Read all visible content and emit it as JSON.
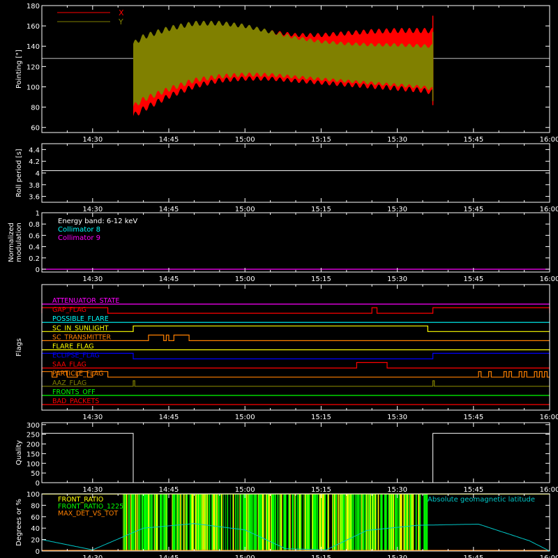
{
  "chart_data": [
    {
      "id": "pointing",
      "type": "line",
      "ylabel": "Pointing [\"]",
      "ylim": [
        55,
        180
      ],
      "yticks": [
        60,
        80,
        100,
        120,
        140,
        160,
        180
      ],
      "xlim": [
        "14:20",
        "16:00"
      ],
      "xticks": [
        "14:30",
        "14:45",
        "15:00",
        "15:15",
        "15:30",
        "15:45",
        "16:00"
      ],
      "legend_placement": "top-left",
      "series": [
        {
          "name": "X",
          "color": "#ff0000",
          "kind": "oscillating band",
          "time": [
            "14:38",
            "14:40",
            "14:45",
            "14:50",
            "14:55",
            "15:00",
            "15:05",
            "15:10",
            "15:15",
            "15:20",
            "15:25",
            "15:30",
            "15:35",
            "15:37"
          ],
          "upper": [
            145,
            150,
            156,
            162,
            163,
            160,
            156,
            153,
            153,
            155,
            157,
            158,
            158,
            158
          ],
          "lower": [
            68,
            75,
            88,
            98,
            104,
            106,
            106,
            104,
            102,
            100,
            98,
            96,
            94,
            92
          ]
        },
        {
          "name": "Y",
          "color": "#808000",
          "kind": "oscillating band",
          "time": [
            "14:38",
            "14:40",
            "14:45",
            "14:50",
            "14:55",
            "15:00",
            "15:05",
            "15:10",
            "15:15",
            "15:20",
            "15:25",
            "15:30",
            "15:35",
            "15:37"
          ],
          "upper": [
            145,
            152,
            160,
            165,
            165,
            162,
            156,
            150,
            146,
            144,
            143,
            143,
            142,
            142
          ],
          "lower": [
            78,
            85,
            95,
            104,
            108,
            110,
            110,
            108,
            106,
            104,
            102,
            100,
            98,
            96
          ]
        }
      ],
      "reference_line": {
        "value": 128,
        "color": "#c0c0c0"
      }
    },
    {
      "id": "roll",
      "type": "line",
      "ylabel": "Roll period [s]",
      "ylim": [
        3.5,
        4.5
      ],
      "yticks": [
        3.6,
        3.8,
        4.0,
        4.2,
        4.4
      ],
      "xlim": [
        "14:20",
        "16:00"
      ],
      "xticks": [
        "14:30",
        "14:45",
        "15:00",
        "15:15",
        "15:30",
        "15:45",
        "16:00"
      ],
      "series": [
        {
          "color": "#ffffff",
          "x": [
            "14:20",
            "16:00"
          ],
          "values": [
            4.04,
            4.04
          ]
        }
      ]
    },
    {
      "id": "modulation",
      "type": "line",
      "ylabel": "Normalized modulation",
      "ylim": [
        -0.05,
        1.0
      ],
      "yticks": [
        0.0,
        0.2,
        0.4,
        0.6,
        0.8,
        1.0
      ],
      "xlim": [
        "14:20",
        "16:00"
      ],
      "xticks": [
        "14:30",
        "14:45",
        "15:00",
        "15:15",
        "15:30",
        "15:45",
        "16:00"
      ],
      "annotation": "Energy band: 6-12 keV",
      "series": [
        {
          "name": "Collimator 8",
          "color": "#00ffff",
          "x": [],
          "values": []
        },
        {
          "name": "Collimator 9",
          "color": "#ff00ff",
          "x": [
            "14:20",
            "16:00"
          ],
          "values": [
            0.0,
            0.0
          ]
        }
      ]
    },
    {
      "id": "flags",
      "type": "line",
      "ylabel": "Flags",
      "xlim": [
        "14:20",
        "16:00"
      ],
      "xticks": [
        "14:30",
        "14:45",
        "15:00",
        "15:15",
        "15:30",
        "15:45",
        "16:00"
      ],
      "series": [
        {
          "name": "ATTENUATOR_STATE",
          "color": "#ff00ff",
          "on": []
        },
        {
          "name": "GAP_FLAG",
          "color": "#ff0000",
          "on": [
            [
              "14:20",
              "14:33"
            ],
            [
              "15:25",
              "15:26"
            ],
            [
              "15:37",
              "16:00"
            ]
          ]
        },
        {
          "name": "POSSIBLE_FLARE",
          "color": "#00ffff",
          "on": []
        },
        {
          "name": "SC_IN_SUNLIGHT",
          "color": "#ffff00",
          "on": [
            [
              "14:38",
              "15:36"
            ]
          ]
        },
        {
          "name": "SC_TRANSMITTER",
          "color": "#ff8000",
          "on": [
            [
              "14:41",
              "14:44"
            ],
            [
              "14:44.5",
              "14:45"
            ],
            [
              "14:46",
              "14:49"
            ]
          ]
        },
        {
          "name": "FLARE_FLAG",
          "color": "#ffff00",
          "on": []
        },
        {
          "name": "ECLIPSE_FLAG",
          "color": "#0000ff",
          "on": [
            [
              "14:20",
              "14:38"
            ],
            [
              "15:37",
              "16:00"
            ]
          ]
        },
        {
          "name": "SAA_FLAG",
          "color": "#ff0000",
          "on": [
            [
              "15:22",
              "15:28"
            ]
          ]
        },
        {
          "name": "PARTICLE_FLAG",
          "color": "#ff8000",
          "on": [
            [
              "14:20",
              "14:22"
            ],
            [
              "14:23",
              "14:25"
            ],
            [
              "14:27",
              "14:29"
            ],
            [
              "14:30",
              "14:33"
            ],
            [
              "15:46",
              "15:46.5"
            ],
            [
              "15:48",
              "15:48.5"
            ],
            [
              "15:51",
              "15:51.5"
            ],
            [
              "15:52",
              "15:52.5"
            ],
            [
              "15:54",
              "15:54.5"
            ],
            [
              "15:55",
              "15:55.5"
            ],
            [
              "15:57",
              "15:57.5"
            ],
            [
              "15:58",
              "15:58.5"
            ],
            [
              "15:59",
              "15:59.5"
            ]
          ]
        },
        {
          "name": "AAZ_FLAG",
          "color": "#808000",
          "on": [
            [
              "14:38",
              "14:38.3"
            ],
            [
              "15:37",
              "15:37.3"
            ]
          ]
        },
        {
          "name": "FRONTS_OFF",
          "color": "#00ff00",
          "on": []
        },
        {
          "name": "BAD_PACKETS",
          "color": "#ff0000",
          "on": []
        }
      ]
    },
    {
      "id": "quality",
      "type": "line",
      "ylabel": "Quality",
      "ylim": [
        0,
        310
      ],
      "yticks": [
        0,
        50,
        100,
        150,
        200,
        250,
        300
      ],
      "xlim": [
        "14:20",
        "16:00"
      ],
      "xticks": [
        "14:30",
        "14:45",
        "15:00",
        "15:15",
        "15:30",
        "15:45",
        "16:00"
      ],
      "series": [
        {
          "color": "#ffffff",
          "x": [
            "14:20",
            "14:38",
            "14:38",
            "15:37",
            "15:37",
            "16:00"
          ],
          "values": [
            255,
            255,
            0,
            0,
            255,
            255
          ]
        }
      ]
    },
    {
      "id": "ratios",
      "type": "line",
      "ylabel": "Degrees or %",
      "ylim": [
        0,
        100
      ],
      "yticks": [
        0,
        20,
        40,
        60,
        80,
        100
      ],
      "xlim": [
        "14:20",
        "16:00"
      ],
      "xticks": [
        "14:30",
        "14:45",
        "15:00",
        "15:15",
        "15:30",
        "15:45",
        "16:00"
      ],
      "series": [
        {
          "name": "FRONT_RATIO",
          "color": "#ffff00",
          "kind": "spikes",
          "range": [
            "14:36",
            "15:36"
          ]
        },
        {
          "name": "FRONT_RATIO_1225",
          "color": "#00ff00",
          "kind": "spikes",
          "range": [
            "14:36",
            "15:36"
          ]
        },
        {
          "name": "MAX_DET_VS_TOT",
          "color": "#ff8000",
          "kind": "baseline",
          "range": [
            "14:20",
            "16:00"
          ]
        },
        {
          "name": "Absolute geomagnetic latitude",
          "color": "#00c8c8",
          "x": [
            "14:20",
            "14:30",
            "14:40",
            "14:50",
            "15:00",
            "15:08",
            "15:16",
            "15:24",
            "15:34",
            "15:46",
            "15:56",
            "16:00"
          ],
          "values": [
            20,
            2,
            40,
            48,
            37,
            4,
            2,
            36,
            45,
            47,
            18,
            0
          ]
        }
      ]
    }
  ]
}
